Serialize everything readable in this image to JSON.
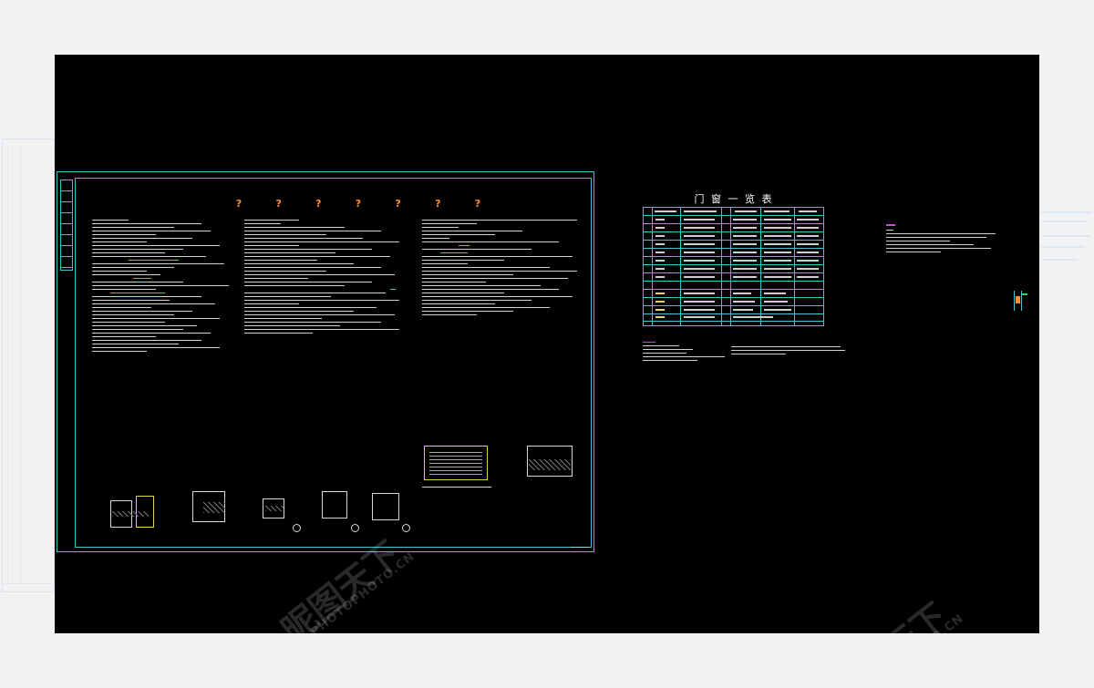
{
  "schedule": {
    "title": "门 窗 一 览 表"
  },
  "watermark": {
    "brand": "昵图天下",
    "site": "PHOTOPHOTO.CN"
  },
  "colors": {
    "background": "#000000",
    "frame": "#3fc2d1",
    "text": "#d8d8d8",
    "accent_green": "#39d94f",
    "accent_orange": "#ff8f2a",
    "accent_yellow": "#e2d34a",
    "accent_magenta": "#e040e0"
  }
}
